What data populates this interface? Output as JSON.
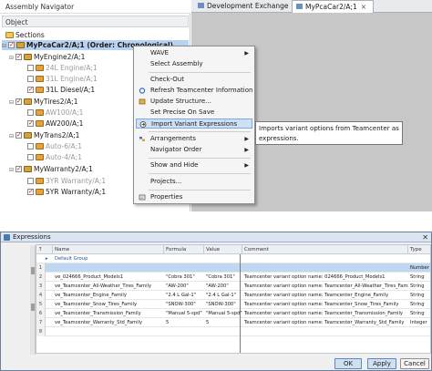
{
  "navigator": {
    "title": "Assembly Navigator",
    "column_header": "Object",
    "items": [
      {
        "label": "Sections",
        "state": "folder"
      },
      {
        "label": "MyPcaCar2/A;1 (Order: Chronological)",
        "state": "selected"
      },
      {
        "label": "MyEngine2/A;1"
      },
      {
        "label": "24L Engine/A;1",
        "dim": true
      },
      {
        "label": "31L Engine/A;1",
        "dim": true
      },
      {
        "label": "31L Diesel/A;1"
      },
      {
        "label": "MyTires2/A;1"
      },
      {
        "label": "AW100/A;1",
        "dim": true
      },
      {
        "label": "AW200/A;1"
      },
      {
        "label": "MyTrans2/A;1"
      },
      {
        "label": "Auto-6/A;1",
        "dim": true
      },
      {
        "label": "Auto-4/A;1",
        "dim": true
      },
      {
        "label": "MyWarranty2/A;1"
      },
      {
        "label": "3YR Warranty/A;1",
        "dim": true
      },
      {
        "label": "5YR Warranty/A;1"
      }
    ]
  },
  "tabs": [
    {
      "label": "Development Exchange"
    },
    {
      "label": "MyPcaCar2/A;1",
      "close": "×"
    }
  ],
  "context_menu": {
    "items": [
      {
        "label": "WAVE",
        "submenu": true
      },
      {
        "label": "Select Assembly"
      },
      {
        "label": "Check-Out"
      },
      {
        "label": "Refresh Teamcenter Information"
      },
      {
        "label": "Update Structure..."
      },
      {
        "label": "Set Precise On Save"
      },
      {
        "label": "Import Variant Expressions",
        "highlighted": true
      },
      {
        "label": "Arrangements",
        "submenu": true
      },
      {
        "label": "Navigator Order",
        "submenu": true
      },
      {
        "label": "Show and Hide",
        "submenu": true
      },
      {
        "label": "Projects..."
      },
      {
        "label": "Properties"
      }
    ],
    "arrow_glyph": "▶"
  },
  "tooltip": {
    "text": "Imports variant options from Teamcenter as expressions."
  },
  "expressions": {
    "title": "Expressions",
    "close_glyph": "✕",
    "columns": [
      "↑",
      "Name",
      "Formula",
      "Value",
      "Comment",
      "Type"
    ],
    "group_label": "Default Group",
    "rows": [
      {
        "num": "1",
        "name": "",
        "formula": "",
        "value": "",
        "comment": "",
        "type": "Number"
      },
      {
        "num": "2",
        "name": "ve_024666_Product_Models1",
        "formula": "\"Cobra 301\"",
        "value": "\"Cobra 301\"",
        "comment": "Teamcenter variant option name: 024666_Product_Models1",
        "type": "String"
      },
      {
        "num": "3",
        "name": "ve_Teamcenter_All-Weather_Tires_Family",
        "formula": "\"AW-200\"",
        "value": "\"AW-200\"",
        "comment": "Teamcenter variant option name: Teamcenter_All-Weather_Tires_Family",
        "type": "String"
      },
      {
        "num": "4",
        "name": "ve_Teamcenter_Engine_Family",
        "formula": "\"2.4 L Gal-1\"",
        "value": "\"2.4 L Gal-1\"",
        "comment": "Teamcenter variant option name: Teamcenter_Engine_Family",
        "type": "String"
      },
      {
        "num": "5",
        "name": "ve_Teamcenter_Snow_Tires_Family",
        "formula": "\"SNOW-300\"",
        "value": "\"SNOW-300\"",
        "comment": "Teamcenter variant option name: Teamcenter_Snow_Tires_Family",
        "type": "String"
      },
      {
        "num": "6",
        "name": "ve_Teamcenter_Transmission_Family",
        "formula": "\"Manual 5-spd\"",
        "value": "\"Manual 5-spd\"",
        "comment": "Teamcenter variant option name: Teamcenter_Transmission_Family",
        "type": "String"
      },
      {
        "num": "7",
        "name": "ve_Teamcenter_Warranty_Std_Family",
        "formula": "5",
        "value": "5",
        "comment": "Teamcenter variant option name: Teamcenter_Warranty_Std_Family",
        "type": "Integer"
      },
      {
        "num": "8",
        "name": "",
        "formula": "",
        "value": "",
        "comment": "",
        "type": ""
      }
    ],
    "buttons": {
      "ok": "OK",
      "apply": "Apply",
      "cancel": "Cancel"
    }
  },
  "colors": {
    "selection": "#b9d2ef",
    "menu_highlight": "#cde0f5",
    "graphics_bg": "#c7c7c7"
  }
}
